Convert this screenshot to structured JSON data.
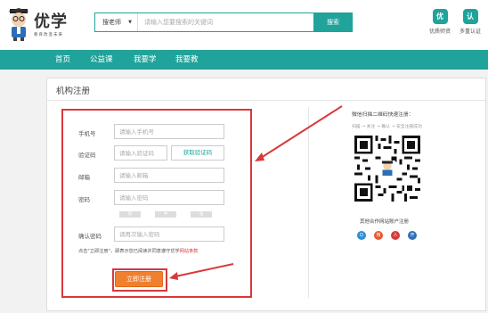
{
  "header": {
    "logo_text": "优学",
    "logo_slogan": "教育改变未来",
    "search_type": "搜老师",
    "search_placeholder": "请输入您要搜索的关键词",
    "search_button": "搜索",
    "links": [
      {
        "badge": "优",
        "label": "优质师资"
      },
      {
        "badge": "认",
        "label": "多重认证"
      }
    ]
  },
  "nav": {
    "items": [
      "首页",
      "公益课",
      "我要学",
      "我要教"
    ]
  },
  "page": {
    "title": "机构注册"
  },
  "form": {
    "phone_label": "手机号",
    "phone_placeholder": "请输入手机号",
    "code_label": "验证码",
    "code_placeholder": "请输入验证码",
    "code_button": "获取验证码",
    "email_label": "邮箱",
    "email_placeholder": "请输入邮箱",
    "password_label": "密码",
    "password_placeholder": "请输入密码",
    "strength": [
      "弱",
      "中",
      "强"
    ],
    "confirm_label": "确认密码",
    "confirm_placeholder": "请再次输入密码",
    "agree_text": "点击\"立即注册\"，即表示您已阅读并同意遵守优学",
    "agree_link": "网站条款",
    "submit": "立即注册"
  },
  "qr": {
    "title": "微信扫描二维码快速注册：",
    "steps": "扫描 → 关注 → 确认 → 安全注册成功"
  },
  "partners": {
    "title": "其他合作网站账户注册",
    "icons": [
      {
        "name": "qq-icon",
        "glyph": "Q",
        "color": "#2a8fd8"
      },
      {
        "name": "weibo-icon",
        "glyph": "微",
        "color": "#e8552b"
      },
      {
        "name": "renren-icon",
        "glyph": "人",
        "color": "#d9383a"
      },
      {
        "name": "kaixin-icon",
        "glyph": "开",
        "color": "#2f6db5"
      }
    ]
  },
  "colors": {
    "brand": "#1fa39a",
    "highlight": "#d9383a",
    "submit": "#f08030"
  }
}
